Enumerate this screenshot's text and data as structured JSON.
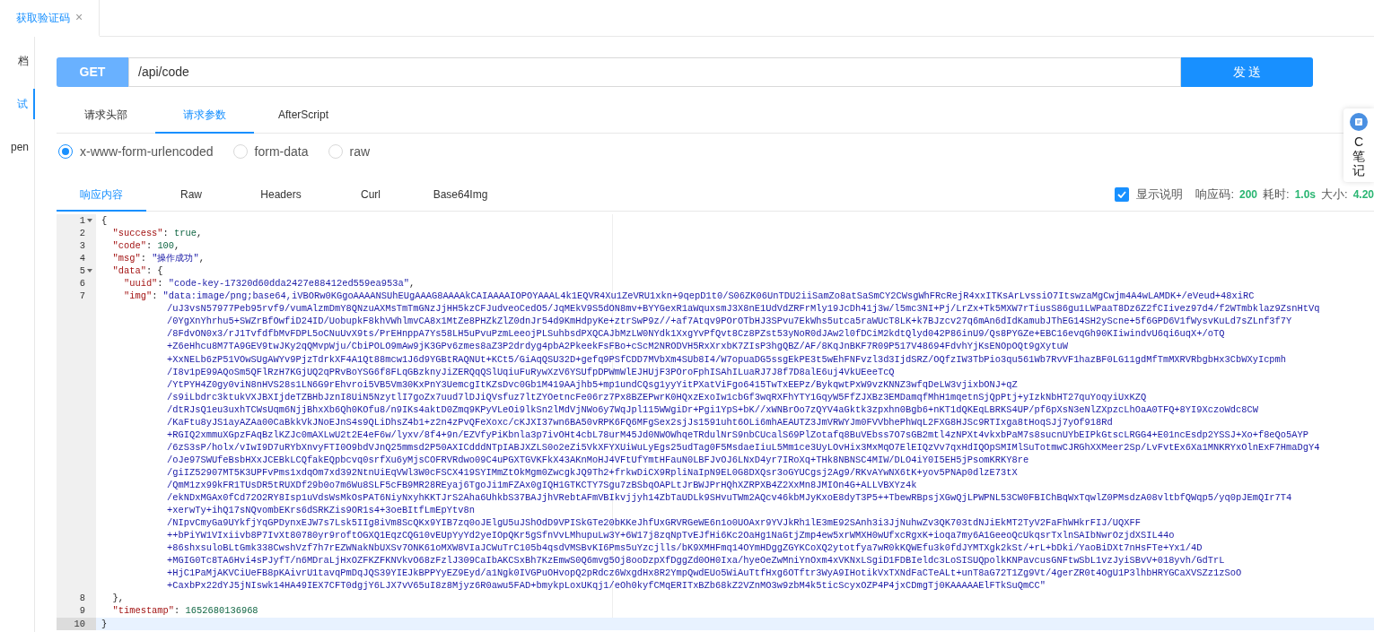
{
  "doc_tabs": [
    {
      "label": "获取验证码",
      "close": "×",
      "selected": true
    }
  ],
  "sidebar": {
    "items": [
      {
        "label": "档",
        "selected": false
      },
      {
        "label": "试",
        "selected": true
      },
      {
        "label": "pen",
        "selected": false
      }
    ]
  },
  "request": {
    "method": "GET",
    "url": "/api/code",
    "send": "发 送"
  },
  "request_tabs": [
    {
      "label": "请求头部",
      "selected": false
    },
    {
      "label": "请求参数",
      "selected": true
    },
    {
      "label": "AfterScript",
      "selected": false
    }
  ],
  "body_types": [
    {
      "label": "x-www-form-urlencoded",
      "selected": true
    },
    {
      "label": "form-data",
      "selected": false
    },
    {
      "label": "raw",
      "selected": false
    }
  ],
  "response_tabs": [
    {
      "label": "响应内容",
      "selected": true
    },
    {
      "label": "Raw",
      "selected": false
    },
    {
      "label": "Headers",
      "selected": false
    },
    {
      "label": "Curl",
      "selected": false
    },
    {
      "label": "Base64Img",
      "selected": false
    }
  ],
  "response_meta": {
    "show_notes": {
      "label": "显示说明",
      "checked": true
    },
    "items": [
      {
        "label": "响应码:",
        "value": "200"
      },
      {
        "label": "耗时:",
        "value": "1.0s"
      },
      {
        "label": "大小:",
        "value": "4.20"
      }
    ]
  },
  "side_widget": {
    "chars": [
      "C",
      "笔",
      "记"
    ]
  },
  "code": {
    "lines": [
      {
        "number": "1",
        "fold": true,
        "active": false,
        "tokens": [
          {
            "kind": "punct",
            "text": "{"
          }
        ]
      },
      {
        "number": "2",
        "fold": false,
        "active": false,
        "tokens": [
          {
            "kind": "key",
            "text": "  \"success\""
          },
          {
            "kind": "punct",
            "text": ": "
          },
          {
            "kind": "literal",
            "text": "true"
          },
          {
            "kind": "punct",
            "text": ","
          }
        ]
      },
      {
        "number": "3",
        "fold": false,
        "active": false,
        "tokens": [
          {
            "kind": "key",
            "text": "  \"code\""
          },
          {
            "kind": "punct",
            "text": ": "
          },
          {
            "kind": "literal",
            "text": "100"
          },
          {
            "kind": "punct",
            "text": ","
          }
        ]
      },
      {
        "number": "4",
        "fold": false,
        "active": false,
        "tokens": [
          {
            "kind": "key",
            "text": "  \"msg\""
          },
          {
            "kind": "punct",
            "text": ": "
          },
          {
            "kind": "string",
            "text": "\"操作成功\""
          },
          {
            "kind": "punct",
            "text": ","
          }
        ]
      },
      {
        "number": "5",
        "fold": true,
        "active": false,
        "tokens": [
          {
            "kind": "key",
            "text": "  \"data\""
          },
          {
            "kind": "punct",
            "text": ": {"
          }
        ]
      },
      {
        "number": "6",
        "fold": false,
        "active": false,
        "tokens": [
          {
            "kind": "key",
            "text": "    \"uuid\""
          },
          {
            "kind": "punct",
            "text": ": "
          },
          {
            "kind": "string",
            "text": "\"code-key-17320d60dda2427e88412ed559ea953a\""
          },
          {
            "kind": "punct",
            "text": ","
          }
        ]
      },
      {
        "number": "7",
        "fold": false,
        "active": false,
        "tokens": [
          {
            "kind": "key",
            "text": "    \"img\""
          },
          {
            "kind": "punct",
            "text": ": "
          },
          {
            "kind": "string",
            "text": "\"data:image/png;base64,iVBORw0KGgoAAAANSUhEUgAAAG8AAAAkCAIAAAAIOPOYAAAL4k1EQVR4Xu1ZeVRU1xkn+9qepD1t0/S06ZK06UnTDU2iiSamZo8atSaSmCY2CWsgWhFRcRejR4xxITKsArLvssiO7ItswzaMgCwjm4A4wLAMDK+/eVeud+48xiRC"
          }
        ],
        "wrapped": [
          "/uJ3vsN57977Peb95rvf9/vumAlzmDmY8QNzuAXMsTmTmGNzJjHH5kzCFJudveoCedO5/JqMEkV9S5dON8mv+BYYGexR1aWquxsmJ3X8nE1UdVdZRFrMly19JcDh41j3w/l5mc3NI+Pj/LrZx+Tk5MXW7rTiusS86gu1LWPaaT8Dz6Z2fCIivez97d4/f2WTmbklaz9ZsnHtVq",
          "/0YgXnYhrhu5+SWZrBfOwfiD24ID/UobupkF8khVWhlmvCA8x1MtZe8PHZkZlZ0dnJr54d9KmHdpyKe+ztrSwP9z//+af7Atqv9POrOTbHJ3SPvu7EkWhs5utca5raWUcT8LK+k7BJzcv27q6mAn6dIdKamubJThEG14SH2yScne+5f6GPD6V1fWysvKuLd7sZLnf3f7Y",
          "/8FdvON0x3/rJ1TvfdfbMvFDPL5oCNuUvX9ts/PrEHnppA7Ys58LH5uPvuPzmLeeojPLSuhbsdPXQCAJbMzLW0NYdk1XxgYvPfQvt8Cz8PZst53yNoR0dJAw2l0fDCiM2kdtQlyd042P86inU9/Qs8PYGZe+EBC16evqGh90KIiwindvU6qi6uqX+/oTQ",
          "+Z6eHhcu8M7TA9GEV9twJKy2qQMvpWju/CbiPOLO9mAw9jK3GPv6zmes8aZ3P2drdyg4pbA2PkeekFsFBo+cScM2NRODVH5RxXrxbK7ZIsP3hgQBZ/AF/8KqJnBKF7R09P517V48694FdvhYjKsENOpOQt9gXytuW",
          "+XxNELb6zP51VOwSUgAWYv9PjzTdrkXF4A1Qt88mcw1J6d9YGBtRAQNUt+KCt5/GiAqQSU32D+gefq9PSfCDD7MVbXm4SUb8I4/W7opuaDG5ssgEkPE3t5wEhFNFvzl3d3IjdSRZ/OQfzIW3TbPio3qu561Wb7RvVF1hazBF0LG11gdMfTmMXRVRbgbHx3CbWXyIcpmh",
          "/I8v1pE99AQoSm5QFlRzH7KGjUQ2qPRvBoYSG6f8FLqGBzknyJiZERQqQSlUqiuFuRywXzV6YSUfpDPWmWlEJHUjF3POroFphISAhILuaRJ7J8f7D8alE6uj4VkUEeeTcQ",
          "/YtPYH4Z0gy0viN8nHVS28s1LN6G9rEhvroi5VB5Vm30KxPnY3UemcgItKZsDvc0Gb1M419AAjhb5+mp1undCQsg1yyYitPXatViFgo6415TwTxEEPz/BykqwtPxW9vzKNNZ3wfqDeLW3vjixbONJ+qZ",
          "/s9iLbdrc3ktukVXJBXIjdeTZBHbJznI8UiN5NzytlI7goZx7uud7lDJiQVsfuz7ltZYOetncFe06rz7Px8BZEPwrK0HQxzExoIw1cbGf3wqRXFhYTY1GqyW5FfZJXBz3EMDamqfMhH1mqetnSjQpPtj+yIzkNbHT27quYoqyiUxKZQ",
          "/dtRJsQ1eu3uxhTCWsUqm6NjjBhxXb6Qh0KOfu8/n9IKs4aktD0Zmq9KPyVLeOi9lkSn2lMdVjNWo6y7WqJpl115WWgiDr+Pgi1YpS+bK//xWNBrOo7zQYV4aGktk3zpxhn0Bgb6+nKT1dQKEqLBRKS4UP/pf6pXsN3eNlZXpzcLhOaA0TFQ+8YI9XczoWdc8CW",
          "/KaFtu8yJS1ayAZAa00CaBkkVkJNoEJnS4s9QLiDhsZ4b1+z2n4zPvQFeXoxc/cKJXI37wn6BA50vRPK6FQ6MFgSex2sjJs1591uht6OLi6mhAEAUTZ3JmVRWYJm0FVVbhePhWqL2FXG8HJSc9RTIxga8tHoqSJj7yOf918Rd",
          "+RGIQ2xmmuXGpzFAqBzlKZJc0mAXLwU2t2E4eF6w/lyxv/8f4+9n/EZVfyPiKbnla3p7ivOHt4cbL78urM45Jd0NWOWhqeTRdulNrS9nbCUcalS69PlZotafq8BuVEbss7O7sGB2mtl4zNPXt4vkxbPaM7s8sucnUYbEIPkGtscLRGG4+E01ncEsdp2YSSJ+Xo+f8eQo5AYP",
          "/6zS3sP/holx/vIwI9D7uRYbXnvyFTI0O9bdVJnQ25mmsd2P50AXICdddNTpIABJXZLS0o2eZi5VkXFYXUiWuLyEgs25udTag0F5MsdaeIiuL5Mm1ce3UyLOvHix3MxMqO7ElEIQzVv7qxHdIQOpSMIMlSuTotmwCJRGhXXMeer2Sp/LvFvtEx6Xa1MNKRYxOlnExF7HmaDgY4",
          "/oJe97SWUfeBsbHXxJCEBkLCQfakEQpbcvq0srfXu6yMjsCOFRVRdwo09C4uPGXTGVKFkX43AKnMoHJ4VFtUfYmtHFauN0LBFJvOJ6LNxD4yr7IRoXq+THk8NBNSC4MIW/DLO4iY0I5EH5jPsomKRKY8re",
          "/giIZ52907MT5K3UPFvPms1xdqOm7xd392NtnUiEqVWl3W0cFSCX419SYIMmZtOkMgm0ZwcgkJQ9Th2+frkwDiCX9RpliNaIpN9EL0G8DXQsr3oGYUCgsj2Ag9/RKvAYwNX6tK+yov5PNAp0dlzE73tX",
          "/QmM1zx99kFR1TUsDR5tRUXDf29b0o7m6Wu8SLF5cFB9MR28REyaj6TgoJi1mFZAx0gIQH1GTKCTY7Sgu7zBSbqOAPLtJrBWJPrHQhXZRPXB4Z2XxMn8JMIOn4G+ALLVBXYz4k",
          "/ekNDxMGAx0fCd72O2RY8Isp1uVdsWsMkOsPAT6NiyNxyhKKTJrS2Aha6UhkbS37BAJjhVRebtAFmVBIkvjjyh14ZbTaUDLk9SHvuTWm2AQcv46kbMJyKxoE8dyT3P5++TbewRBpsjXGwQjLPWPNL53CW0FBIChBqWxTqwlZ0PMsdzA08vltbfQWqp5/yq0pJEmQIr7T4",
          "+xerwTy+ihQ17sNQvombEKrs6dSRKZis9OR1s4+3oeBItfLmEpYtv8n",
          "/NIpvCmyGa9UYkfjYqGPDynxEJW7s7Lsk5IIg8iVm8ScQKx9YIB7zq0oJElgU5uJShOdD9VPISkGTe20bKKeJhfUxGRVRGeWE6n1o0UOAxr9YVJkRh1lE3mE92SAnh3i3JjNuhwZv3QK703tdNJiEkMT2TyV2FaFhWHkrFIJ/UQXFF",
          "++bPiYW1VIxiivb8P7IvXt80780yr9roftOGXQ1EqzCQG10vEUpYyYd2yeIOpQKr5gSfnVvLMhupuLw3Y+6W17j8zqNpTvEJfHi6Kc2OaHg1NaGtjZmp4ew5xrWMXH0wUfxcRgxK+ioqa7my6A1GeeoQcUkqsrTxlnSAIbNwrOzjdXSIL44o",
          "+86shxsuloBLtGmk338CwshVzf7h7rEZWNakNbUXSv7ONK61oMXW8VIaJCWuTrC105b4qsdVMSBvKI6Pms5uYzcjlls/bK9XMHFmq14OYmHDggZGYKCoXQ2ytotfya7wR0kKQWEfu3k0fdJYMTXgk2kSt/+rL+bDki/YaoBiDXt7nHsFTe+Yx1/4D",
          "+MGIG0Tc8TA6Hvi4sPJyfT/n6MDraLjHxOZFKZFKNVkvO68zFzlJ309CaIbAKCSxBh7KzEmwS0Q6mvg5Oj8ooDzpXfDggZd0OH0Ixa/hyeOeZwMniYnOxm4xVKNxLSgiD1FDBIeldc3LoSISUQpolkKNPavcusGNFtwSbL1vzJyiSBvV+018yvh/GdTrL",
          "+HjC1PaMjAKVCiUeFB8pKAivrU1tavqPmDqJQS39YIEJkBPPYyEZ9Eyd/a1Ngk0IVGPuOHvopQ2pRdcz6WxgdHx8R2YmpQwdEUo5WiAuTtfHxg6OTftr3WyA9IHotikVxTXNdFaCTeALt+unT8aG72T1Zg9Vt/4gerZR0t4OgU1P3lhbHRYGCaXVSZz1zSoO",
          "+CaxbPx22dYJ5jNIswk14HA49IEX7CFT0dgjY6LJX7vV65uI8z8Mjyz6R0awu5FAD+bmykpLoxUKqj1/eOh0kyfCMqERITxBZb68kZ2VZnMO3w9zbM4k5ticScyxOZP4P4jxCDmgTj0KAAAAAElFTkSuQmCC\""
        ]
      },
      {
        "number": "8",
        "fold": false,
        "active": false,
        "tokens": [
          {
            "kind": "punct",
            "text": "  },"
          }
        ]
      },
      {
        "number": "9",
        "fold": false,
        "active": false,
        "tokens": [
          {
            "kind": "key",
            "text": "  \"timestamp\""
          },
          {
            "kind": "punct",
            "text": ": "
          },
          {
            "kind": "literal",
            "text": "1652680136968"
          }
        ]
      },
      {
        "number": "10",
        "fold": false,
        "active": true,
        "tokens": [
          {
            "kind": "punct",
            "text": "}"
          }
        ]
      }
    ]
  }
}
